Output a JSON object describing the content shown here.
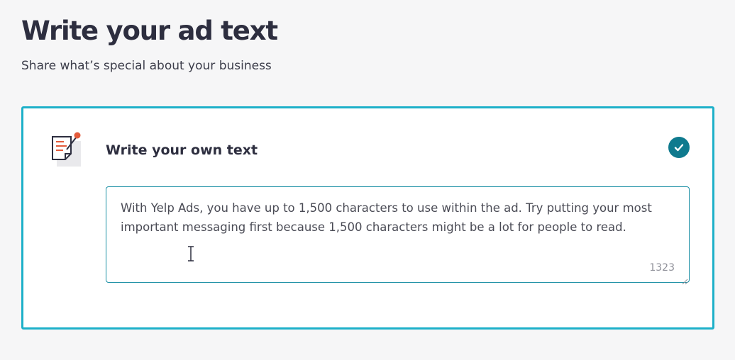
{
  "header": {
    "title": "Write your ad text",
    "subtitle": "Share what’s special about your business"
  },
  "option": {
    "title": "Write your own text",
    "selected": true,
    "icon": "document-edit-icon",
    "ad_text": "With Yelp Ads, you have up to 1,500 characters to use within the ad. Try putting your most important messaging first because 1,500 characters might be a lot for people to read.",
    "char_count": "1323"
  },
  "colors": {
    "accent_border": "#1db0c9",
    "check_badge": "#0f7a8e",
    "title_text": "#2d2e3f",
    "icon_red": "#e35b3b"
  }
}
